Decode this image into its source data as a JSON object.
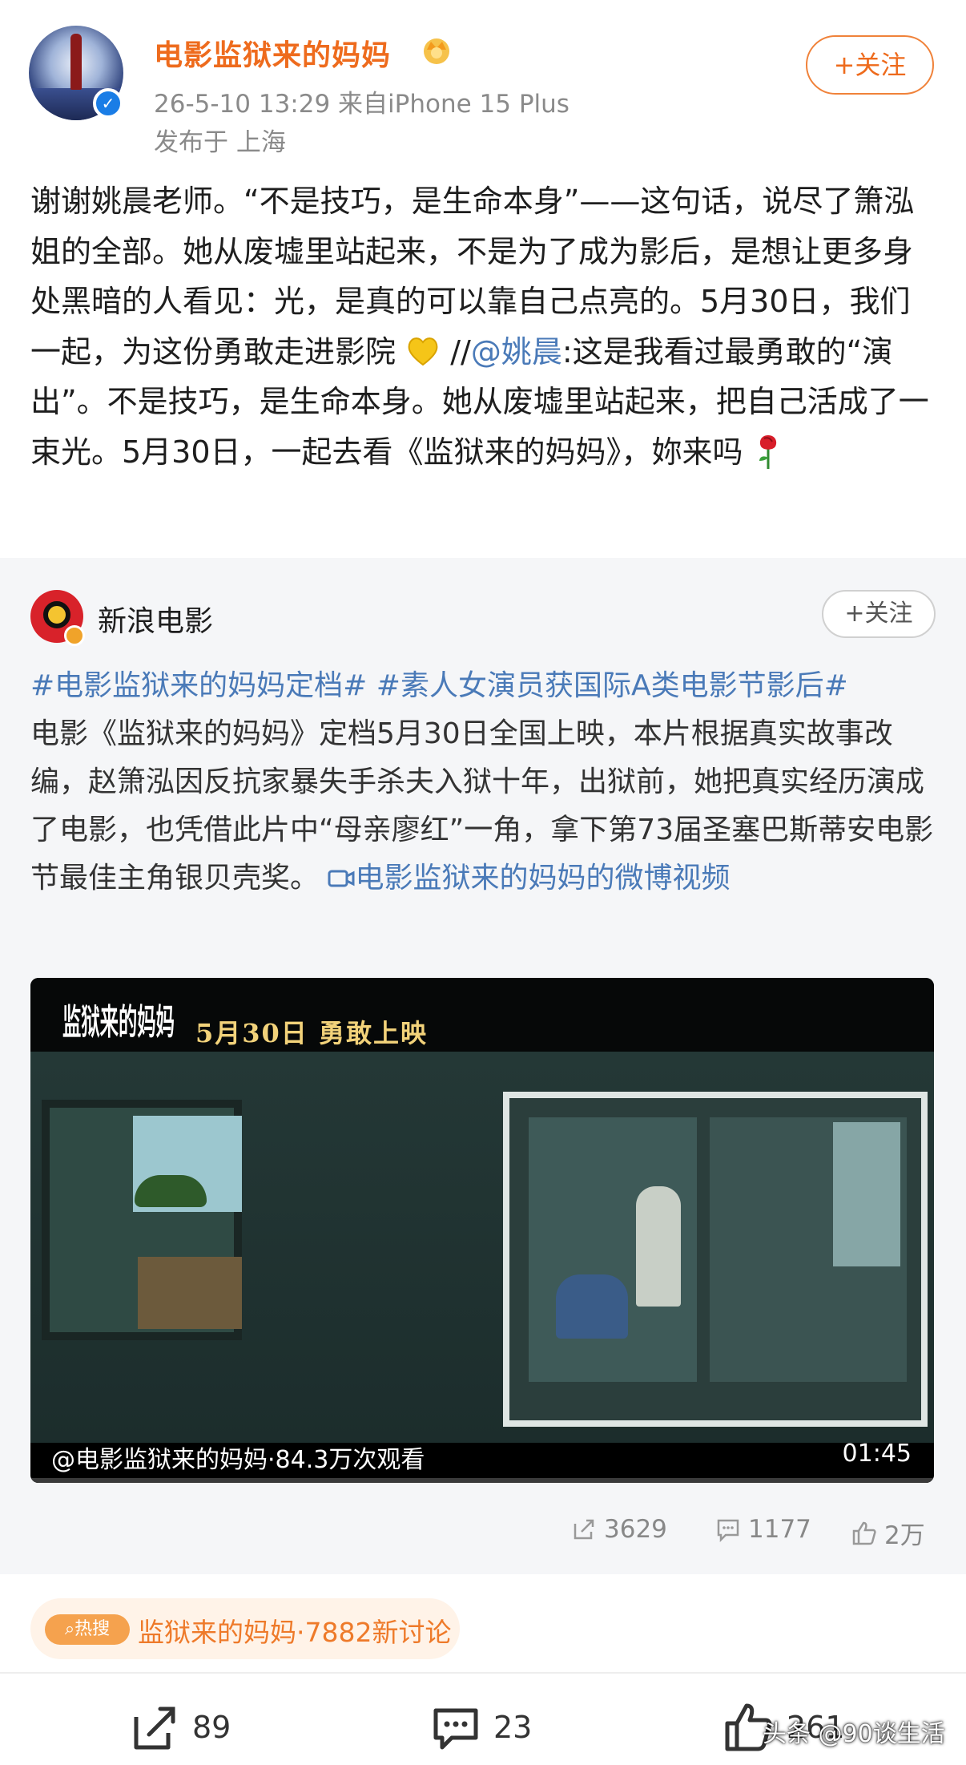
{
  "post": {
    "author": "电影监狱来的妈妈",
    "meta_time_device": "26-5-10 13:29  来自iPhone 15 Plus",
    "meta_location": "发布于 上海",
    "follow_label": "+关注",
    "text_part1": "谢谢姚晨老师。“不是技巧，是生命本身”——这句话，说尽了箫泓姐的全部。她从废墟里站起来，不是为了成为影后，是想让更多身处黑暗的人看见：光，是真的可以靠自己点亮的。5月30日，我们一起，为这份勇敢走进影院",
    "text_part2": "//",
    "mention": "@姚晨",
    "text_part3": ":这是我看过最勇敢的“演出”。不是技巧，是生命本身。她从废墟里站起来，把自己活成了一束光。5月30日，一起去看《监狱来的妈妈》，妳来吗"
  },
  "repost": {
    "author": "新浪电影",
    "follow_label": "+关注",
    "tag1": "#电影监狱来的妈妈定档#",
    "tag2": "#素人女演员获国际A类电影节影后#",
    "body": "电影《监狱来的妈妈》定档5月30日全国上映，本片根据真实故事改编，赵箫泓因反抗家暴失手杀夫入狱十年，出狱前，她把真实经历演成了电影，也凭借此片中“母亲廖红”一角，拿下第73届圣塞巴斯蒂安电影节最佳主角银贝壳奖。",
    "video_link": "电影监狱来的妈妈的微博视频",
    "video": {
      "logo_text": "监狱来的妈妈",
      "banner": "5月30日  勇敢上映",
      "caption": "@电影监狱来的妈妈·84.3万次观看",
      "duration": "01:45"
    },
    "actions": {
      "share_count": "3629",
      "comment_count": "1177",
      "like_count": "2万"
    }
  },
  "hot": {
    "badge": "热搜",
    "text": "监狱来的妈妈·7882新讨论"
  },
  "bottom": {
    "share_count": "89",
    "comment_count": "23",
    "like_count": "261"
  },
  "watermark": "头条 @90谈生活",
  "colors": {
    "accent_orange": "#ee6b1d",
    "link_blue": "#4a7ab8",
    "verified_blue": "#1a7de6"
  }
}
